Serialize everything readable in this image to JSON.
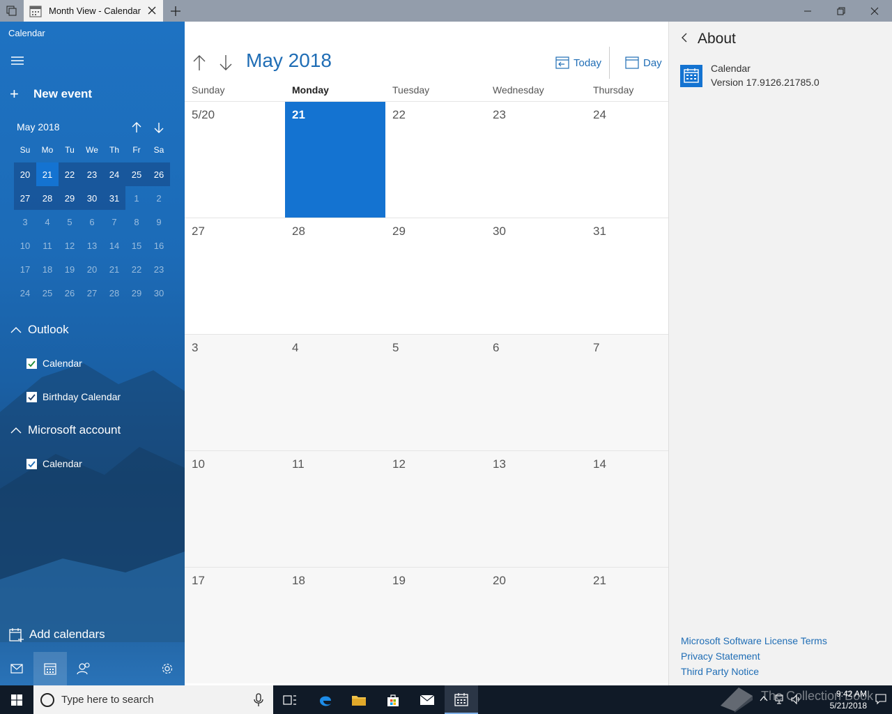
{
  "window": {
    "tab_title": "Month View - Calendar"
  },
  "sidebar": {
    "app_name": "Calendar",
    "new_event_label": "New event",
    "mini_calendar": {
      "month_label": "May 2018",
      "weekdays": [
        "Su",
        "Mo",
        "Tu",
        "We",
        "Th",
        "Fr",
        "Sa"
      ],
      "weeks": [
        [
          "20",
          "21",
          "22",
          "23",
          "24",
          "25",
          "26"
        ],
        [
          "27",
          "28",
          "29",
          "30",
          "31",
          "1",
          "2"
        ],
        [
          "3",
          "4",
          "5",
          "6",
          "7",
          "8",
          "9"
        ],
        [
          "10",
          "11",
          "12",
          "13",
          "14",
          "15",
          "16"
        ],
        [
          "17",
          "18",
          "19",
          "20",
          "21",
          "22",
          "23"
        ],
        [
          "24",
          "25",
          "26",
          "27",
          "28",
          "29",
          "30"
        ]
      ]
    },
    "groups": [
      {
        "name": "Outlook",
        "calendars": [
          "Calendar",
          "Birthday Calendar"
        ]
      },
      {
        "name": "Microsoft account",
        "calendars": [
          "Calendar"
        ]
      }
    ],
    "add_calendars_label": "Add calendars"
  },
  "main": {
    "month_title": "May 2018",
    "today_label": "Today",
    "day_label": "Day",
    "day_headers": [
      "Sunday",
      "Monday",
      "Tuesday",
      "Wednesday",
      "Thursday"
    ],
    "weeks": [
      [
        "5/20",
        "21",
        "22",
        "23",
        "24"
      ],
      [
        "27",
        "28",
        "29",
        "30",
        "31"
      ],
      [
        "3",
        "4",
        "5",
        "6",
        "7"
      ],
      [
        "10",
        "11",
        "12",
        "13",
        "14"
      ],
      [
        "17",
        "18",
        "19",
        "20",
        "21"
      ]
    ]
  },
  "about": {
    "title": "About",
    "app_name": "Calendar",
    "version": "Version 17.9126.21785.0",
    "links": [
      "Microsoft Software License Terms",
      "Privacy Statement",
      "Third Party Notice"
    ]
  },
  "taskbar": {
    "search_placeholder": "Type here to search",
    "time": "9:42 AM",
    "date": "5/21/2018",
    "watermark": "The Collection Book"
  },
  "colors": {
    "accent": "#1f6db5",
    "today_fill": "#1473d1",
    "taskbar": "#101a27",
    "titlebar": "#939dab"
  }
}
